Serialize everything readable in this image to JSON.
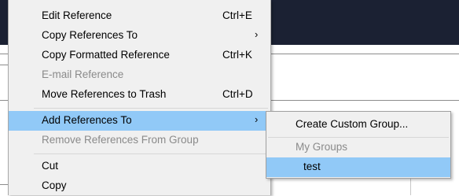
{
  "colors": {
    "title_bar": "#1b2133",
    "menu_bg": "#f0f0f0",
    "highlight": "#91c9f7",
    "disabled_text": "#8a8a8a"
  },
  "context_menu": {
    "items": [
      {
        "label": "Edit Reference",
        "shortcut": "Ctrl+E"
      },
      {
        "label": "Copy References To",
        "submenu_arrow": "›"
      },
      {
        "label": "Copy Formatted Reference",
        "shortcut": "Ctrl+K"
      },
      {
        "label": "E-mail Reference",
        "disabled": true
      },
      {
        "label": "Move References to Trash",
        "shortcut": "Ctrl+D"
      },
      {
        "label": "Add References To",
        "submenu_arrow": "›",
        "highlighted": true
      },
      {
        "label": "Remove References From Group",
        "disabled": true
      },
      {
        "label": "Cut"
      },
      {
        "label": "Copy"
      }
    ]
  },
  "submenu": {
    "create_group": "Create Custom Group...",
    "groups_heading": "My Groups",
    "groups": [
      "test"
    ]
  }
}
